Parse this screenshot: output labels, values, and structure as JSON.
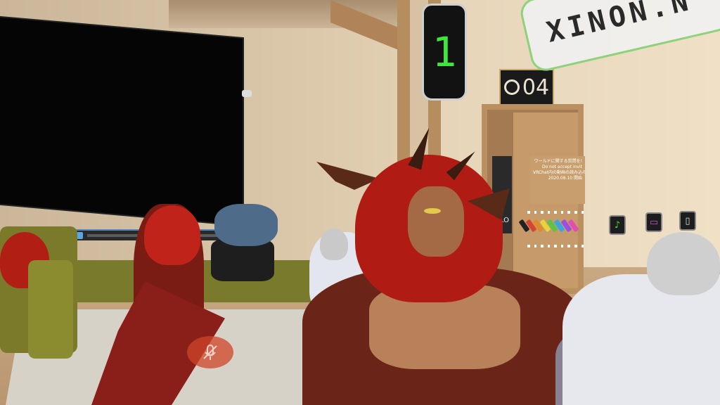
{
  "scene": {
    "type": "vr-social-room"
  },
  "player_counter": {
    "value": "1",
    "color": "#3ee63e"
  },
  "room_sign": {
    "icon": "person-icon",
    "number": "04"
  },
  "nameplate": {
    "text": "XINON.N",
    "border_color": "#8ed27a"
  },
  "door_sign": {
    "label": "CLO"
  },
  "notice_board": {
    "lines": [
      "ワールドに関する質問を!",
      "Do not accept invit",
      "VRChat内の動画の読み込みを",
      "2020.08.10 開始"
    ]
  },
  "marker_colors": [
    "#222222",
    "#d9442f",
    "#e08a30",
    "#e6d23a",
    "#5fc24a",
    "#3aa6e0",
    "#9b4ee0",
    "#e04fb0"
  ],
  "wall_buttons": [
    {
      "icon": "music-note-icon",
      "glyph": "♪",
      "color": "#3ee63e"
    },
    {
      "icon": "screen-icon",
      "glyph": "▭",
      "color": "#c64fe0"
    },
    {
      "icon": "phone-icon",
      "glyph": "▯",
      "color": "#dddddd"
    }
  ],
  "hud": {
    "mic_muted_icon": "mic-muted-icon"
  }
}
